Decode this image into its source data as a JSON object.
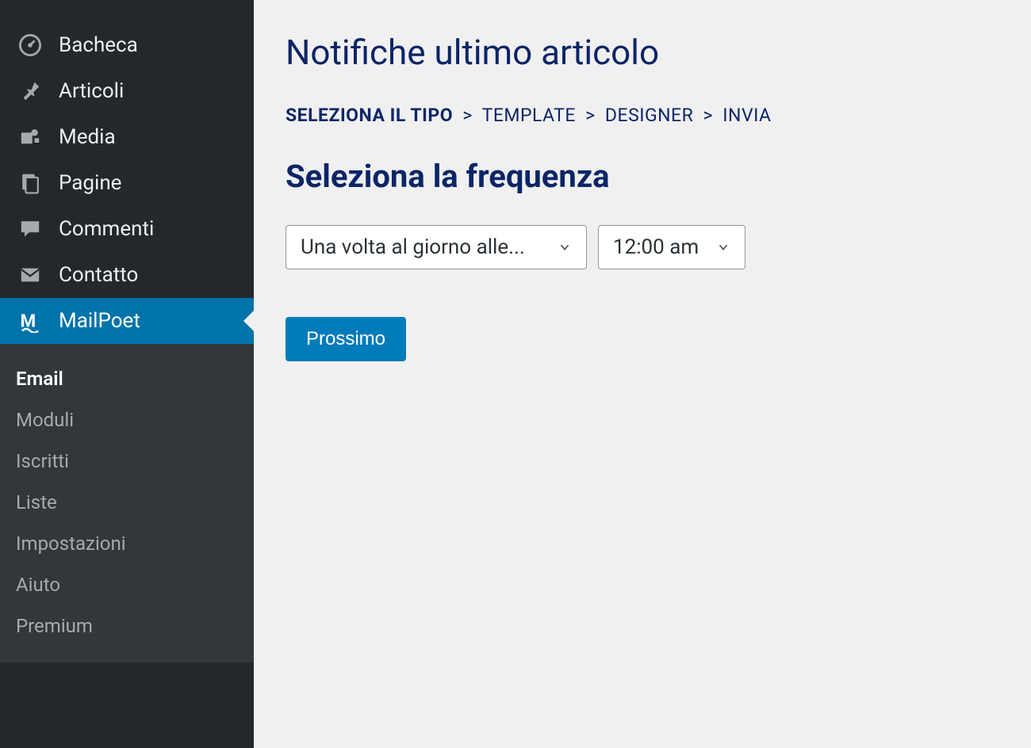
{
  "sidebar": {
    "items": [
      {
        "label": "Bacheca",
        "icon": "dashboard"
      },
      {
        "label": "Articoli",
        "icon": "pin"
      },
      {
        "label": "Media",
        "icon": "media"
      },
      {
        "label": "Pagine",
        "icon": "pages"
      },
      {
        "label": "Commenti",
        "icon": "comment"
      },
      {
        "label": "Contatto",
        "icon": "mail"
      },
      {
        "label": "MailPoet",
        "icon": "mailpoet",
        "active": true
      }
    ],
    "submenu": [
      {
        "label": "Email",
        "active": true
      },
      {
        "label": "Moduli"
      },
      {
        "label": "Iscritti"
      },
      {
        "label": "Liste"
      },
      {
        "label": "Impostazioni"
      },
      {
        "label": "Aiuto"
      },
      {
        "label": "Premium"
      }
    ]
  },
  "main": {
    "title": "Notifiche ultimo articolo",
    "breadcrumb": {
      "steps": [
        "SELEZIONA IL TIPO",
        "TEMPLATE",
        "DESIGNER",
        "INVIA"
      ],
      "active_index": 0,
      "separator": ">"
    },
    "subheading": "Seleziona la frequenza",
    "frequency_select": {
      "value": "Una volta al giorno alle..."
    },
    "time_select": {
      "value": "12:00 am"
    },
    "next_button": "Prossimo"
  }
}
